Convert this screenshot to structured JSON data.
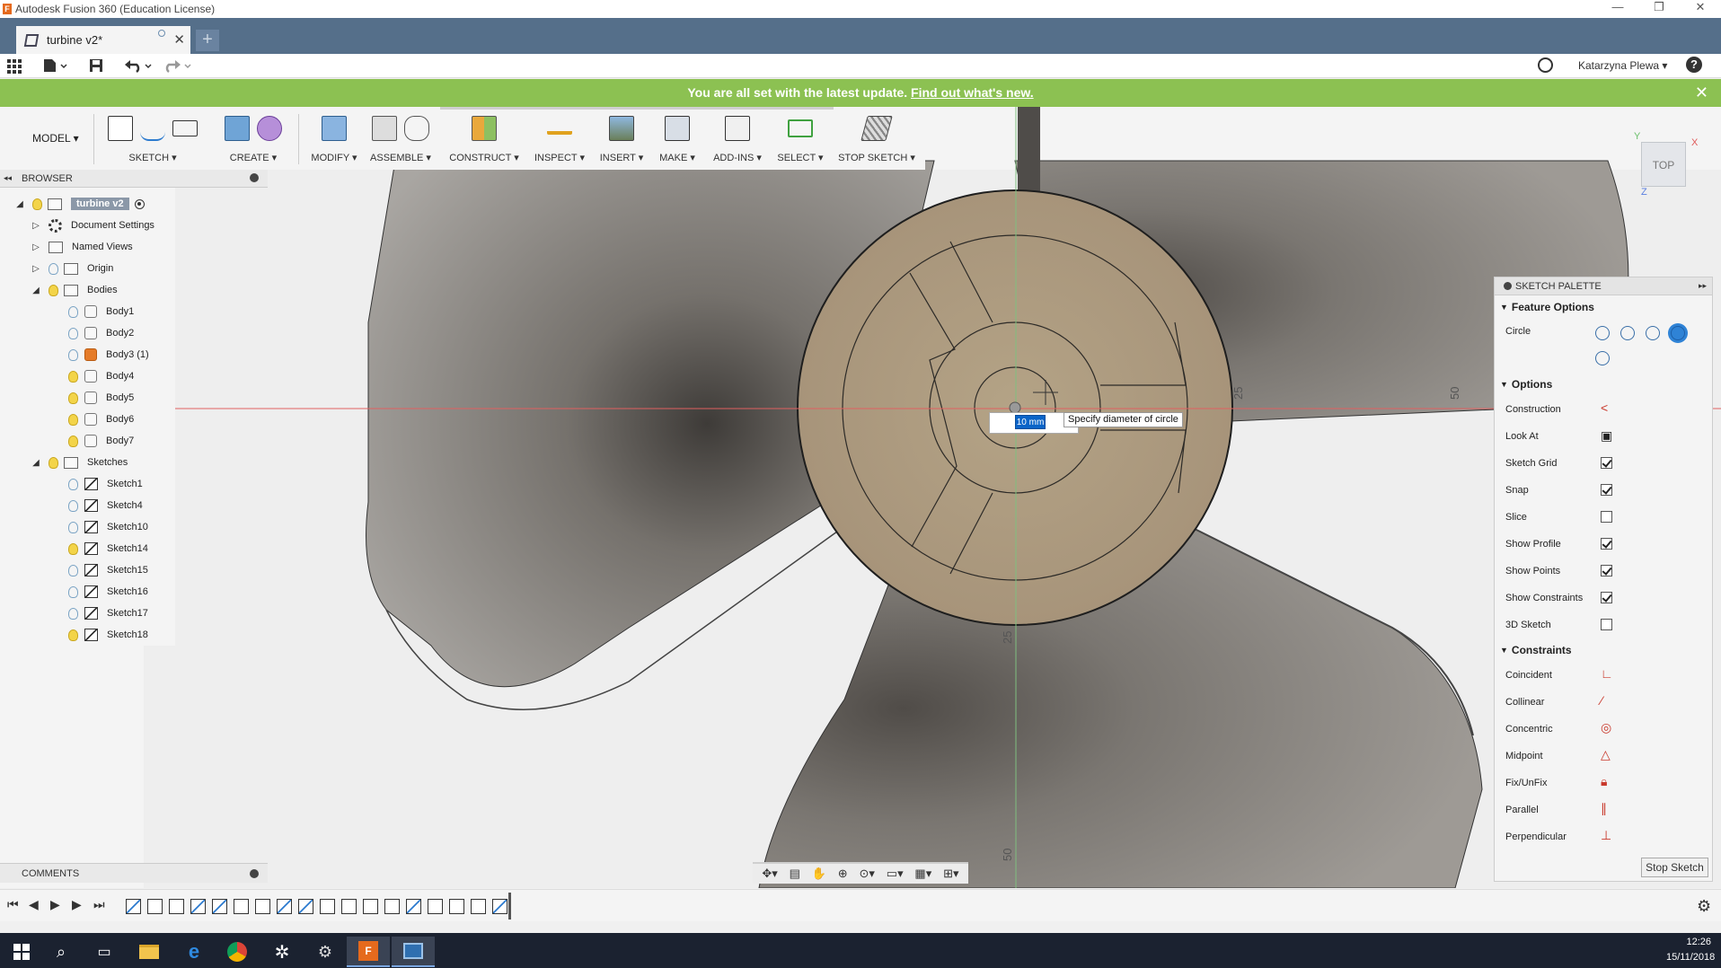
{
  "window": {
    "title": "Autodesk Fusion 360 (Education License)",
    "minimize": "—",
    "maximize": "❐",
    "close": "✕"
  },
  "tabs": {
    "document_name": "turbine v2*",
    "close": "✕",
    "new_tab": "+"
  },
  "quick_access": {
    "user_name": "Katarzyna Plewa ▾",
    "help": "?"
  },
  "banner": {
    "message": "You are all set with the latest update.",
    "link": "Find out what's new.",
    "close": "✕"
  },
  "toolbar": {
    "workspace": "MODEL ▾",
    "groups": [
      "SKETCH ▾",
      "CREATE ▾",
      "MODIFY ▾",
      "ASSEMBLE ▾",
      "CONSTRUCT ▾",
      "INSPECT ▾",
      "INSERT ▾",
      "MAKE ▾",
      "ADD-INS ▾",
      "SELECT ▾",
      "STOP SKETCH ▾"
    ]
  },
  "browser": {
    "title": "BROWSER",
    "root": "turbine v2",
    "items": [
      "Document Settings",
      "Named Views",
      "Origin",
      "Bodies",
      "Body1",
      "Body2",
      "Body3 (1)",
      "Body4",
      "Body5",
      "Body6",
      "Body7",
      "Sketches",
      "Sketch1",
      "Sketch4",
      "Sketch10",
      "Sketch14",
      "Sketch15",
      "Sketch16",
      "Sketch17",
      "Sketch18"
    ]
  },
  "comments": {
    "title": "COMMENTS"
  },
  "viewcube": {
    "face": "TOP",
    "axis_x": "X",
    "axis_y": "Y",
    "axis_z": "Z"
  },
  "viewport": {
    "ruler_labels": [
      "25",
      "50",
      "25",
      "50"
    ]
  },
  "dimension_input": {
    "value": "10 mm",
    "tooltip": "Specify diameter of circle"
  },
  "sketch_palette": {
    "title": "SKETCH PALETTE",
    "feature_options": "Feature Options",
    "circle_label": "Circle",
    "options_title": "Options",
    "options": [
      {
        "label": "Construction",
        "icon": "construction-icon"
      },
      {
        "label": "Look At",
        "icon": "look-at-icon"
      },
      {
        "label": "Sketch Grid",
        "checked": true
      },
      {
        "label": "Snap",
        "checked": true
      },
      {
        "label": "Slice",
        "checked": false
      },
      {
        "label": "Show Profile",
        "checked": true
      },
      {
        "label": "Show Points",
        "checked": true
      },
      {
        "label": "Show Constraints",
        "checked": true
      },
      {
        "label": "3D Sketch",
        "checked": false
      }
    ],
    "constraints_title": "Constraints",
    "constraints": [
      "Coincident",
      "Collinear",
      "Concentric",
      "Midpoint",
      "Fix/UnFix",
      "Parallel",
      "Perpendicular"
    ],
    "stop_button": "Stop Sketch"
  },
  "taskbar": {
    "time": "12:26",
    "date": "15/11/2018"
  },
  "colors": {
    "tab_bar": "#556f8a",
    "banner": "#8cc152",
    "selection": "#0a64c8",
    "hub": "#b7a588",
    "blade": "#6d6a66"
  }
}
